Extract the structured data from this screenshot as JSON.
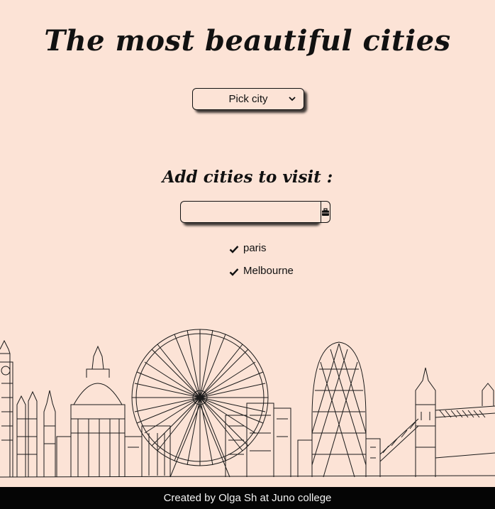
{
  "header": {
    "title": "The most beautiful cities"
  },
  "city_picker": {
    "selected": "Pick city"
  },
  "add_section": {
    "heading": "Add cities to visit :",
    "input_value": "",
    "button_icon": "suitcase-icon"
  },
  "visit_list": {
    "items": [
      {
        "label": "paris",
        "icon": "check-icon"
      },
      {
        "label": "Melbourne",
        "icon": "check-icon"
      }
    ]
  },
  "footer": {
    "text": "Created by Olga Sh at Juno college"
  },
  "colors": {
    "background": "#fce3d6",
    "footer_bg": "#050505",
    "ink": "#111111"
  }
}
